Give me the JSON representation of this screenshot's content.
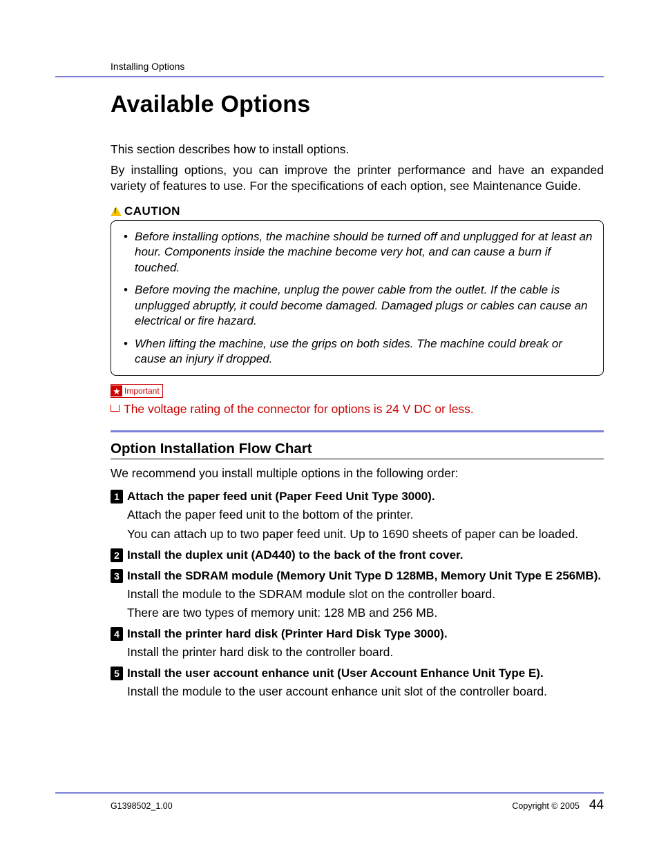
{
  "header": {
    "section": "Installing Options"
  },
  "title": "Available Options",
  "intro1": "This section describes how to install options.",
  "intro2": "By installing options, you can improve the printer performance and have an expanded variety of features to use. For the specifications of each option, see Maintenance Guide.",
  "caution": {
    "label": "CAUTION",
    "items": [
      "Before installing options, the machine should be turned off and unplugged for at least an hour. Components inside the machine become very hot, and can cause a burn if touched.",
      "Before moving the machine, unplug the power cable from the outlet. If the cable is unplugged abruptly, it could become damaged. Damaged plugs or cables can cause an electrical or fire hazard.",
      "When lifting the machine, use the grips on both sides. The machine could break or cause an injury if dropped."
    ]
  },
  "important": {
    "badge": "Important",
    "note": "The voltage rating of the connector for options is 24 V DC or less."
  },
  "subhead": "Option Installation Flow Chart",
  "sub_intro": "We recommend you install multiple options in the following order:",
  "steps": [
    {
      "num": "1",
      "title": "Attach the paper feed unit (Paper Feed Unit Type 3000).",
      "body1": "Attach the paper feed unit to the bottom of the printer.",
      "body2": "You can attach up to two paper feed unit. Up to 1690 sheets of paper can be loaded."
    },
    {
      "num": "2",
      "title": "Install the duplex unit (AD440) to the back of the front cover."
    },
    {
      "num": "3",
      "title": "Install the SDRAM module (Memory Unit Type D 128MB, Memory Unit Type E 256MB).",
      "body1": "Install the module to the SDRAM module slot on the controller board.",
      "body2": "There are two types of memory unit: 128 MB and 256 MB."
    },
    {
      "num": "4",
      "title": "Install the printer hard disk (Printer Hard Disk Type 3000).",
      "body1": "Install the printer hard disk to the controller board."
    },
    {
      "num": "5",
      "title": "Install the user account enhance unit (User Account Enhance Unit Type E).",
      "body1": "Install the module to the user account enhance unit slot of the controller board."
    }
  ],
  "footer": {
    "doc_id": "G1398502_1.00",
    "copyright": "Copyright © 2005",
    "page": "44"
  }
}
